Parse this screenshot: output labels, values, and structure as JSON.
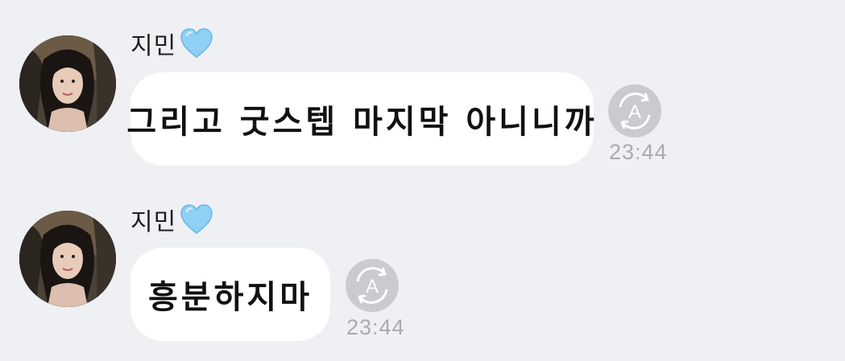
{
  "messages": [
    {
      "sender": "지민",
      "sender_icon": "light-blue-heart-icon",
      "text": "그리고 굿스텝 마지막 아니니까",
      "time": "23:44",
      "action_icon": "auto-translate-icon",
      "action_label": "A"
    },
    {
      "sender": "지민",
      "sender_icon": "light-blue-heart-icon",
      "text": "흥분하지마",
      "time": "23:44",
      "action_icon": "auto-translate-icon",
      "action_label": "A"
    }
  ],
  "colors": {
    "background": "#eef0f4",
    "bubble": "#ffffff",
    "heart": "#8fd0f5",
    "timestamp": "#a9abb0",
    "action_button": "#c9cbcf"
  }
}
